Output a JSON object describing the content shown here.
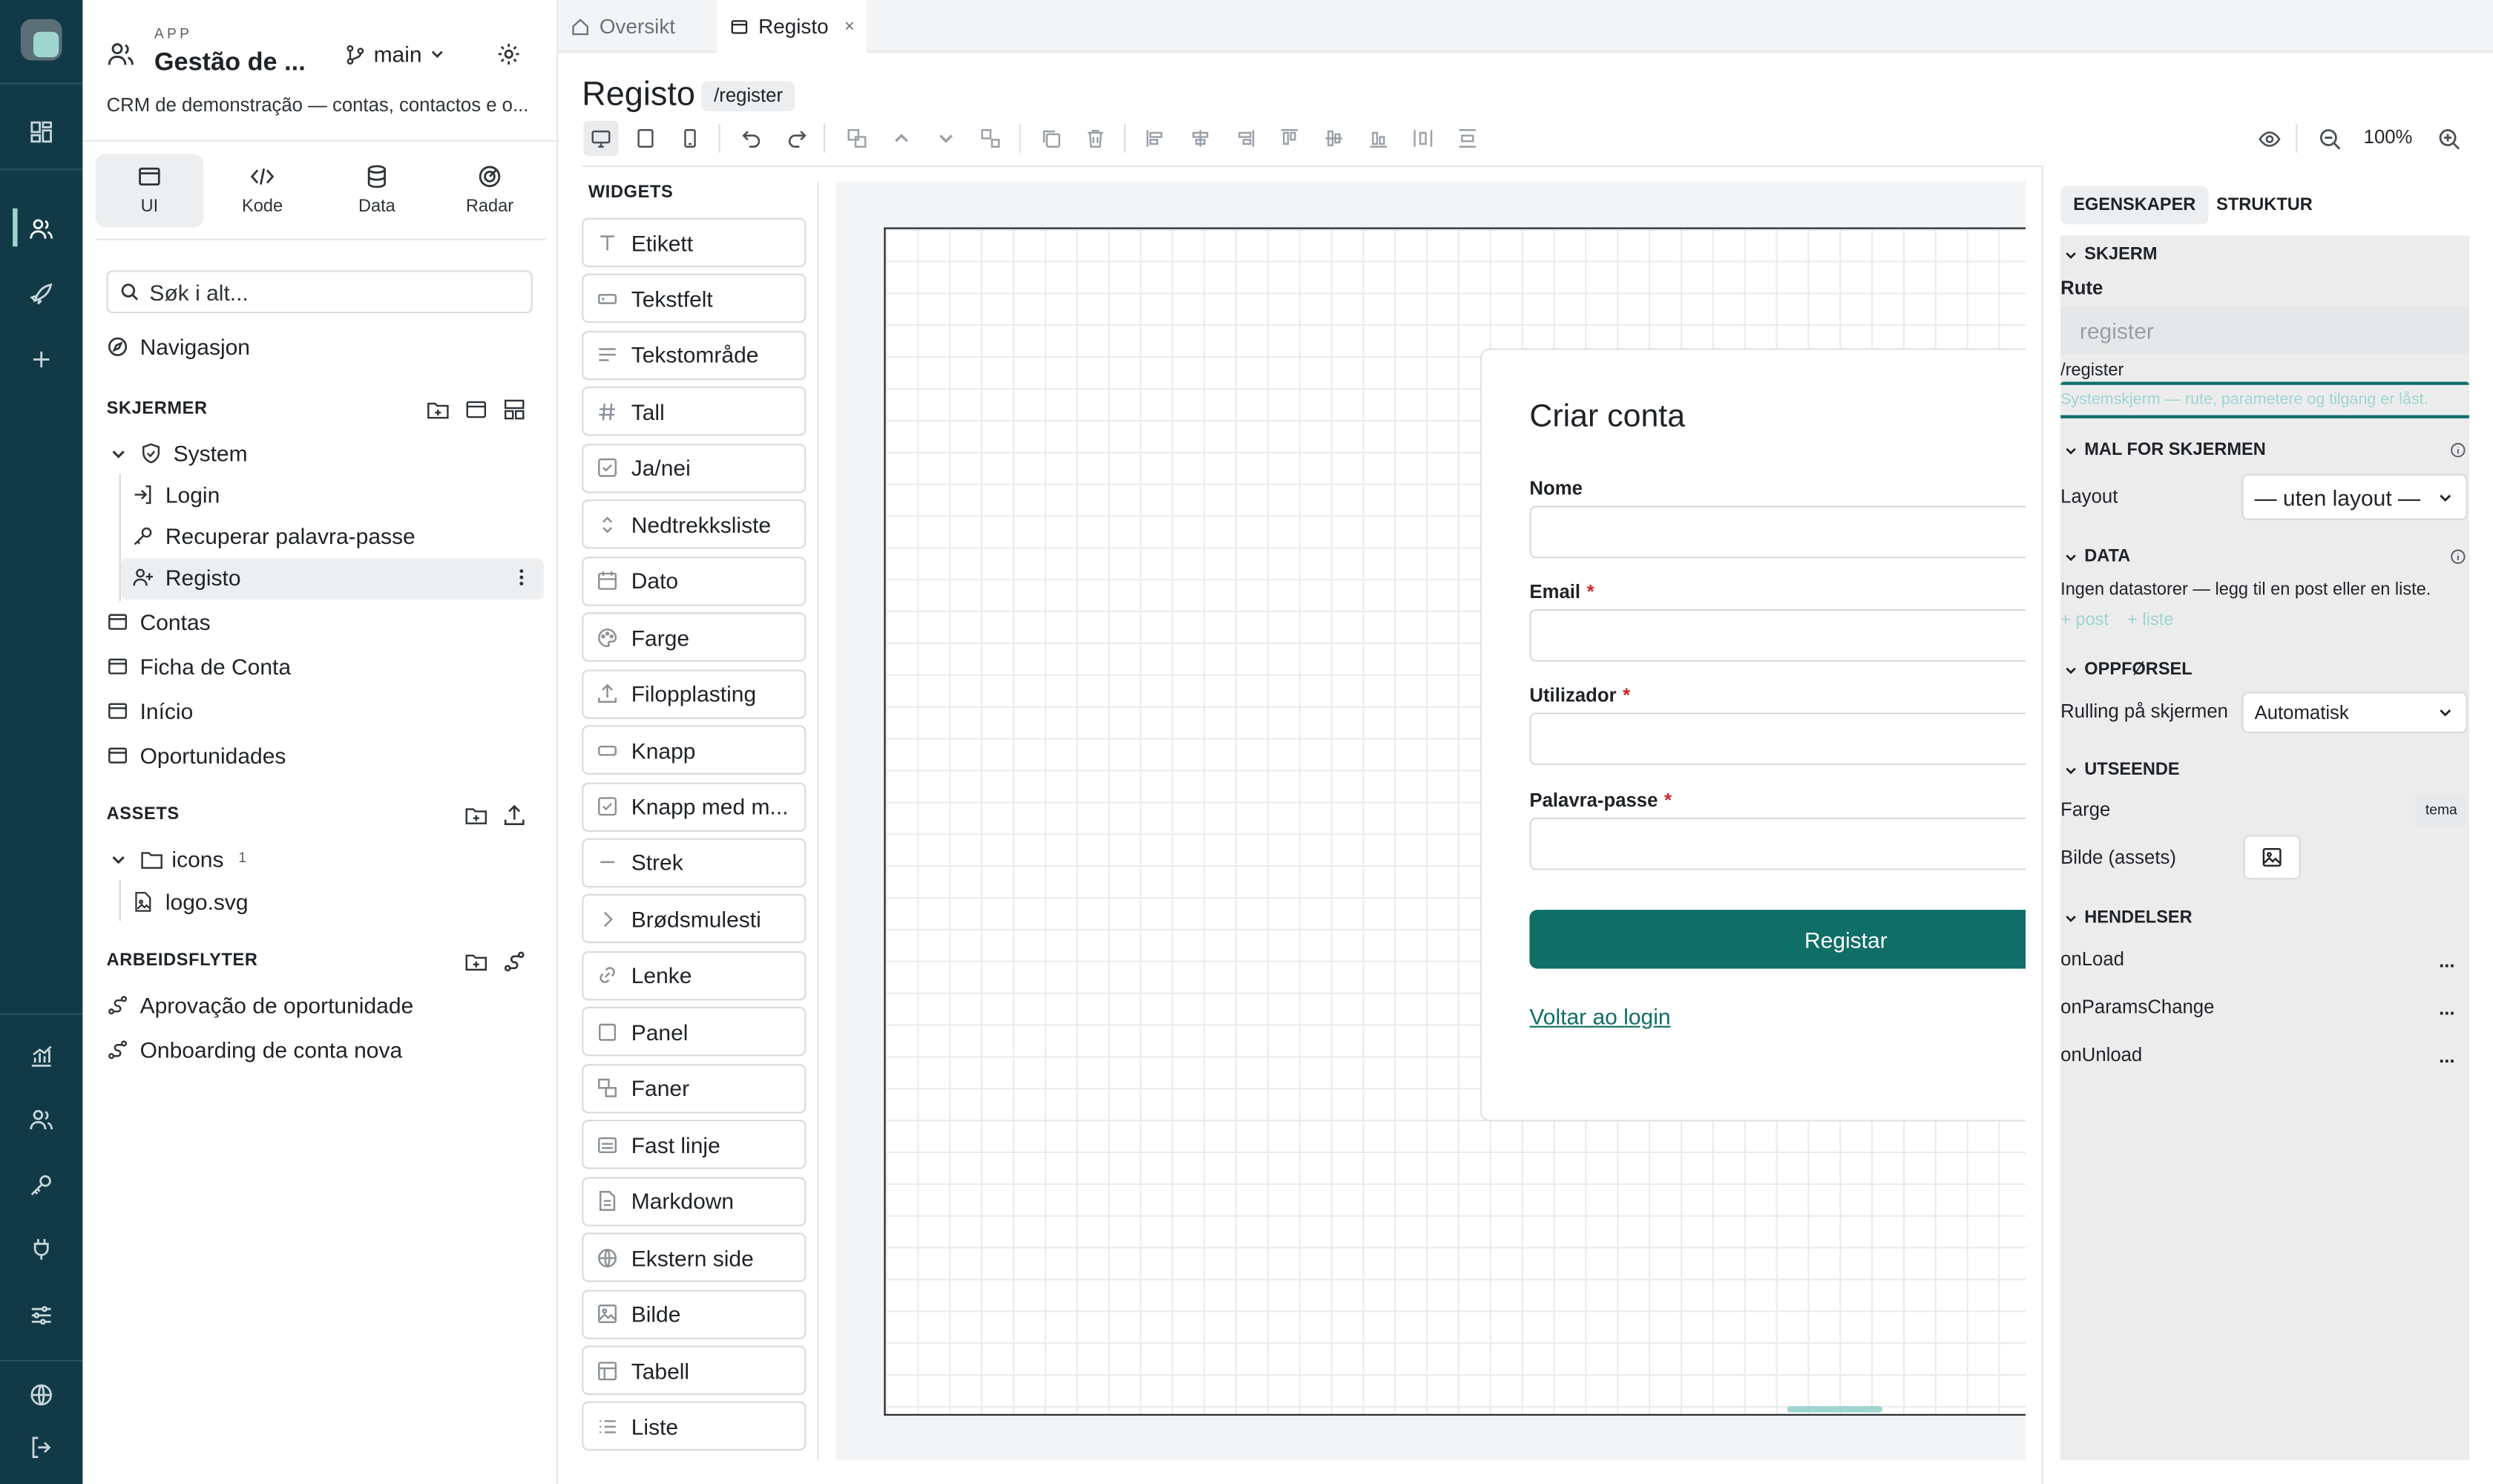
{
  "app": {
    "caption": "APP",
    "title": "Gestão de ...",
    "branch": "main",
    "description": "CRM de demonstração — contas, contactos e o..."
  },
  "mode_tabs": [
    {
      "label": "UI",
      "icon": "window-icon"
    },
    {
      "label": "Kode",
      "icon": "code-icon"
    },
    {
      "label": "Data",
      "icon": "database-icon"
    },
    {
      "label": "Radar",
      "icon": "radar-icon"
    }
  ],
  "search": {
    "placeholder": "Søk i alt..."
  },
  "nav": {
    "label": "Navigasjon"
  },
  "screens": {
    "title": "SKJERMER",
    "system_group": "System",
    "system_items": [
      "Login",
      "Recuperar palavra-passe",
      "Registo"
    ],
    "items": [
      "Contas",
      "Ficha de Conta",
      "Início",
      "Oportunidades"
    ]
  },
  "assets": {
    "title": "ASSETS",
    "folder": "icons",
    "folder_count": "1",
    "file": "logo.svg"
  },
  "workflows": {
    "title": "ARBEIDSFLYTER",
    "items": [
      "Aprovação de oportunidade",
      "Onboarding de conta nova"
    ]
  },
  "tabs": [
    {
      "label": "Oversikt"
    },
    {
      "label": "Registo",
      "close": "×"
    }
  ],
  "page": {
    "title": "Registo",
    "route_badge": "/register"
  },
  "toolbar": {
    "zoom": "100%"
  },
  "widgets": {
    "title": "WIDGETS",
    "items": [
      {
        "label": "Etikett",
        "icon": "text-icon"
      },
      {
        "label": "Tekstfelt",
        "icon": "textfield-icon"
      },
      {
        "label": "Tekstområde",
        "icon": "textarea-icon"
      },
      {
        "label": "Tall",
        "icon": "hash-icon"
      },
      {
        "label": "Ja/nei",
        "icon": "checkbox-icon"
      },
      {
        "label": "Nedtrekksliste",
        "icon": "select-icon"
      },
      {
        "label": "Dato",
        "icon": "calendar-icon"
      },
      {
        "label": "Farge",
        "icon": "palette-icon"
      },
      {
        "label": "Filopplasting",
        "icon": "upload-icon"
      },
      {
        "label": "Knapp",
        "icon": "button-icon"
      },
      {
        "label": "Knapp med m...",
        "icon": "checkbox-icon"
      },
      {
        "label": "Strek",
        "icon": "divider-icon"
      },
      {
        "label": "Brødsmulesti",
        "icon": "chevron-right-icon"
      },
      {
        "label": "Lenke",
        "icon": "link-icon"
      },
      {
        "label": "Panel",
        "icon": "panel-icon"
      },
      {
        "label": "Faner",
        "icon": "tabs-icon"
      },
      {
        "label": "Fast linje",
        "icon": "fixed-line-icon"
      },
      {
        "label": "Markdown",
        "icon": "markdown-icon"
      },
      {
        "label": "Ekstern side",
        "icon": "globe-icon"
      },
      {
        "label": "Bilde",
        "icon": "image-icon"
      },
      {
        "label": "Tabell",
        "icon": "table-icon"
      },
      {
        "label": "Liste",
        "icon": "list-icon"
      }
    ]
  },
  "form": {
    "title": "Criar conta",
    "fields": [
      {
        "label": "Nome",
        "required": false
      },
      {
        "label": "Email",
        "required": true
      },
      {
        "label": "Utilizador",
        "required": true
      },
      {
        "label": "Palavra-passe",
        "required": true
      }
    ],
    "required_mark": "*",
    "submit": "Registar",
    "back_link": "Voltar ao login"
  },
  "props": {
    "tab_properties": "EGENSKAPER",
    "tab_structure": "STRUKTUR",
    "screen_section": "SKJERM",
    "route_label": "Rute",
    "route_value": "register",
    "route_path": "/register",
    "system_note": "Systemskjerm — rute, parametere og tilgang er låst.",
    "template_section": "MAL FOR SKJERMEN",
    "layout_label": "Layout",
    "layout_value": "— uten layout —",
    "data_section": "DATA",
    "data_note": "Ingen datastorer — legg til en post eller en liste.",
    "add_post": "+ post",
    "add_list": "+ liste",
    "behavior_section": "OPPFØRSEL",
    "scroll_label": "Rulling på skjermen",
    "scroll_value": "Automatisk",
    "appearance_section": "UTSEENDE",
    "color_label": "Farge",
    "color_value": "tema",
    "image_label": "Bilde (assets)",
    "events_section": "HENDELSER",
    "events": [
      "onLoad",
      "onParamsChange",
      "onUnload"
    ],
    "event_menu": "..."
  },
  "colors": {
    "brand": "#0f6e66",
    "rail": "#123a46",
    "required": "#d1242f"
  }
}
